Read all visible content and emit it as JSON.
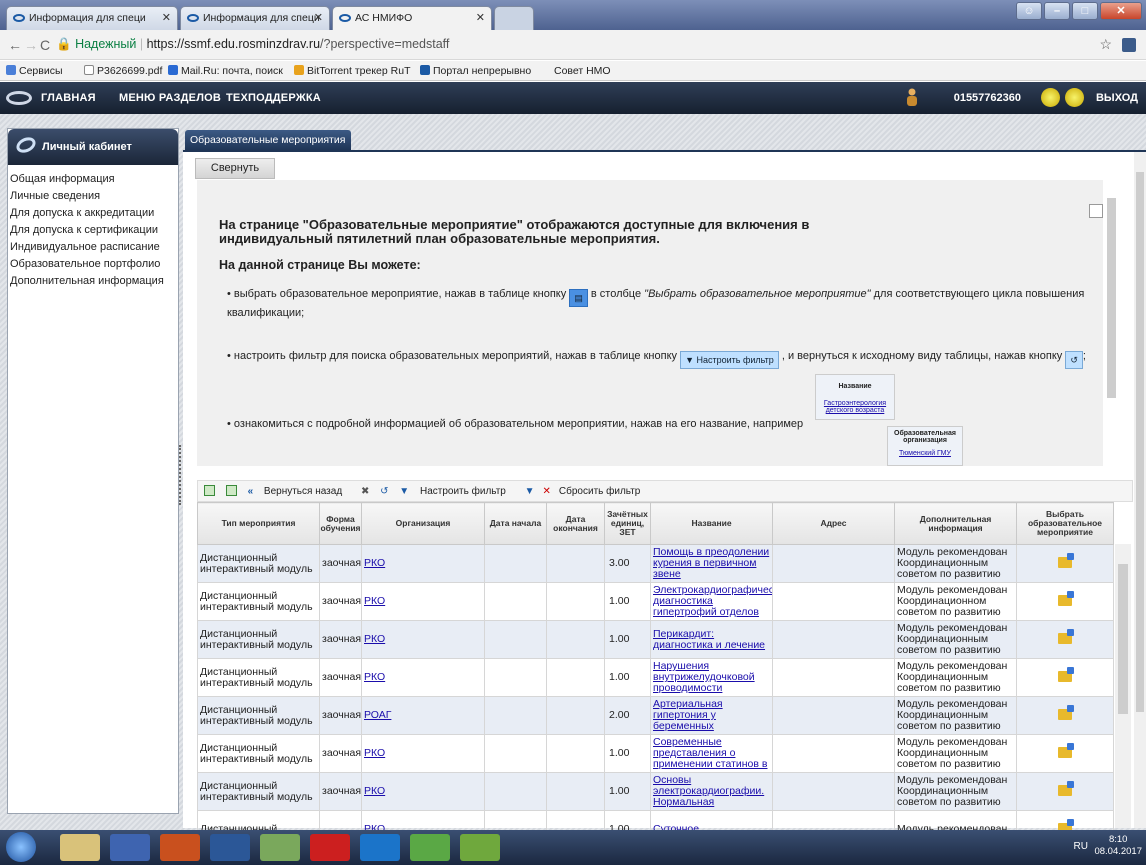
{
  "browser": {
    "tabs": [
      {
        "title": "Информация для специ"
      },
      {
        "title": "Информация для специ"
      },
      {
        "title": "АС НМИФО"
      }
    ],
    "secure_label": "Надежный",
    "url_host": "https://ssmf.edu.rosminzdrav.ru",
    "url_path": "/?perspective=medstaff",
    "bookmarks": [
      "Сервисы",
      "Р3626699.pdf",
      "Mail.Ru: почта, поиск",
      "BitTorrent трекер RuT",
      "Портал непрерывно",
      "Совет НМО"
    ]
  },
  "site_nav": {
    "items": [
      "ГЛАВНАЯ",
      "МЕНЮ РАЗДЕЛОВ",
      "ТЕХПОДДЕРЖКА"
    ],
    "user_id": "01557762360",
    "logout": "ВЫХОД"
  },
  "sidebar": {
    "title": "Личный кабинет",
    "items": [
      "Общая информация",
      "Личные сведения",
      "Для допуска к аккредитации",
      "Для допуска к сертификации",
      "Индивидуальное расписание",
      "Образовательное портфолио",
      "Дополнительная информация"
    ]
  },
  "main": {
    "tab": "Образовательные мероприятия",
    "collapse_button": "Свернуть",
    "info": {
      "heading": "На странице \"Образовательные мероприятие\" отображаются доступные для включения в индивидуальный пятилетний план образовательные мероприятия.",
      "subheading": "На данной странице Вы можете:",
      "bullet1_a": "• выбрать образовательное мероприятие, нажав в таблице кнопку",
      "bullet1_b": "в столбце",
      "bullet1_c": "\"Выбрать образовательное мероприятие\"",
      "bullet1_d": "для соответствующего цикла повышения квалификации;",
      "bullet2_a": "• настроить фильтр для поиска образовательных мероприятий, нажав в таблице кнопку",
      "bullet2_btn": "Настроить фильтр",
      "bullet2_b": ", и вернуться к исходному виду таблицы, нажав кнопку",
      "bullet3": "• ознакомиться с подробной информацией об образовательном мероприятии, нажав на его название, например",
      "example_name_header": "Название",
      "example_name_link": "Гастроэнтерология детского возраста",
      "example_org_header": "Образовательная организация",
      "example_org_link": "Тюменский ГМУ"
    },
    "toolbar": {
      "back": "Вернуться назад",
      "filter": "Настроить фильтр",
      "reset": "Сбросить фильтр"
    },
    "table": {
      "columns": [
        "Тип мероприятия",
        "Форма обучения",
        "Организация",
        "Дата начала",
        "Дата окончания",
        "Зачётных единиц, ЗЕТ",
        "Название",
        "Адрес",
        "Дополнительная информация",
        "Выбрать образовательное мероприятие"
      ],
      "rows": [
        {
          "type": "Дистанционный интерактивный модуль",
          "form": "заочная",
          "org": "РКО",
          "start": "",
          "end": "",
          "zet": "3.00",
          "name": "Помощь в преодолении курения в первичном звене",
          "address": "",
          "info": "Модуль рекомендован Координационным советом по развитию"
        },
        {
          "type": "Дистанционный интерактивный модуль",
          "form": "заочная",
          "org": "РКО",
          "start": "",
          "end": "",
          "zet": "1.00",
          "name": "Электрокардиографическая диагностика гипертрофий отделов",
          "address": "",
          "info": "Модуль рекомендован Координационном советом по развитию"
        },
        {
          "type": "Дистанционный интерактивный модуль",
          "form": "заочная",
          "org": "РКО",
          "start": "",
          "end": "",
          "zet": "1.00",
          "name": "Перикардит: диагностика и лечение",
          "address": "",
          "info": "Модуль рекомендован Координационным советом по развитию"
        },
        {
          "type": "Дистанционный интерактивный модуль",
          "form": "заочная",
          "org": "РКО",
          "start": "",
          "end": "",
          "zet": "1.00",
          "name": "Нарушения внутрижелудочковой проводимости",
          "address": "",
          "info": "Модуль рекомендован Координационным советом по развитию"
        },
        {
          "type": "Дистанционный интерактивный модуль",
          "form": "заочная",
          "org": "РОАГ",
          "start": "",
          "end": "",
          "zet": "2.00",
          "name": "Артериальная гипертония у беременных",
          "address": "",
          "info": "Модуль рекомендован Координационным советом по развитию"
        },
        {
          "type": "Дистанционный интерактивный модуль",
          "form": "заочная",
          "org": "РКО",
          "start": "",
          "end": "",
          "zet": "1.00",
          "name": "Современные представления о применении статинов в",
          "address": "",
          "info": "Модуль рекомендован Координационным советом по развитию"
        },
        {
          "type": "Дистанционный интерактивный модуль",
          "form": "заочная",
          "org": "РКО",
          "start": "",
          "end": "",
          "zet": "1.00",
          "name": "Основы электрокардиографии. Нормальная",
          "address": "",
          "info": "Модуль рекомендован Координационным советом по развитию"
        },
        {
          "type": "Дистанционный",
          "form": "",
          "org": "РКО",
          "start": "",
          "end": "",
          "zet": "1.00",
          "name": "Суточное",
          "address": "",
          "info": "Модуль рекомендован"
        }
      ]
    }
  },
  "taskbar": {
    "lang": "RU",
    "time": "8:10",
    "date": "08.04.2017"
  }
}
